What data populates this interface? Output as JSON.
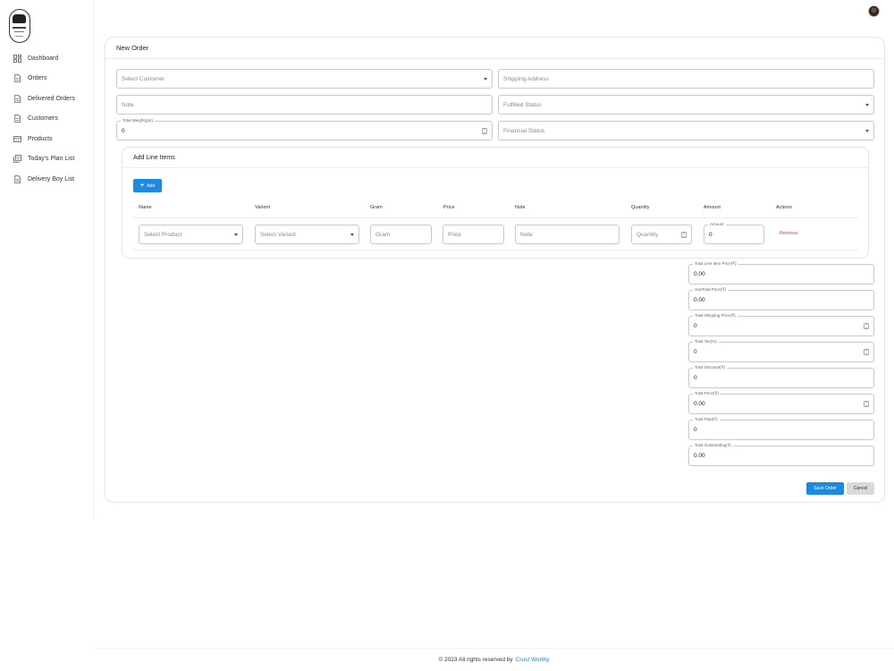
{
  "sidebar": {
    "items": [
      {
        "label": "Dashboard",
        "icon": "dashboard-icon"
      },
      {
        "label": "Orders",
        "icon": "document-icon"
      },
      {
        "label": "Delivered Orders",
        "icon": "document-icon"
      },
      {
        "label": "Customers",
        "icon": "document-icon"
      },
      {
        "label": "Products",
        "icon": "products-icon"
      },
      {
        "label": "Today's Plan List",
        "icon": "plan-list-icon"
      },
      {
        "label": "Delivery Boy List",
        "icon": "document-icon"
      }
    ]
  },
  "page_title": "New Order",
  "form": {
    "customer_placeholder": "Select Customer",
    "shipping_placeholder": "Shipping Address",
    "note_placeholder": "Note",
    "fulfilled_placeholder": "Fulfilled Status",
    "weight_label": "Total Weight(gm)",
    "weight_value": "0",
    "financial_placeholder": "Financial Status"
  },
  "line_items": {
    "title": "Add Line Items",
    "add_label": "Add",
    "columns": [
      "Name",
      "Varient",
      "Gram",
      "Price",
      "Note",
      "Quantity",
      "Amount",
      "Actions"
    ],
    "row": {
      "product_placeholder": "Select Product",
      "variant_placeholder": "Select Variant",
      "gram_placeholder": "Gram",
      "price_placeholder": "Price",
      "note_placeholder": "Note",
      "quantity_placeholder": "Quantity",
      "amount_label": "Amount",
      "amount_value": "0",
      "remove_label": "Remove"
    }
  },
  "totals": [
    {
      "label": "Total Line Item Price(₹)",
      "value": "0.00",
      "spin": false
    },
    {
      "label": "SubTotal Price(₹)",
      "value": "0.00",
      "spin": false
    },
    {
      "label": "Total Shipping Price(₹)",
      "value": "0",
      "spin": true
    },
    {
      "label": "Total Tax(%)",
      "value": "0",
      "spin": true
    },
    {
      "label": "Total Discount(₹)",
      "value": "0",
      "spin": false
    },
    {
      "label": "Total Price(₹)",
      "value": "0.00",
      "spin": true
    },
    {
      "label": "Total Paid(₹)",
      "value": "0",
      "spin": false
    },
    {
      "label": "Total Outstanding(₹)",
      "value": "0.00",
      "spin": false
    }
  ],
  "actions": {
    "save_label": "Save Order",
    "cancel_label": "Cancel"
  },
  "footer": {
    "text": "© 2023 All rights reserved by",
    "link": "Crust Worthy"
  },
  "colors": {
    "accent": "#1a8be5",
    "danger": "#e23d4d"
  }
}
